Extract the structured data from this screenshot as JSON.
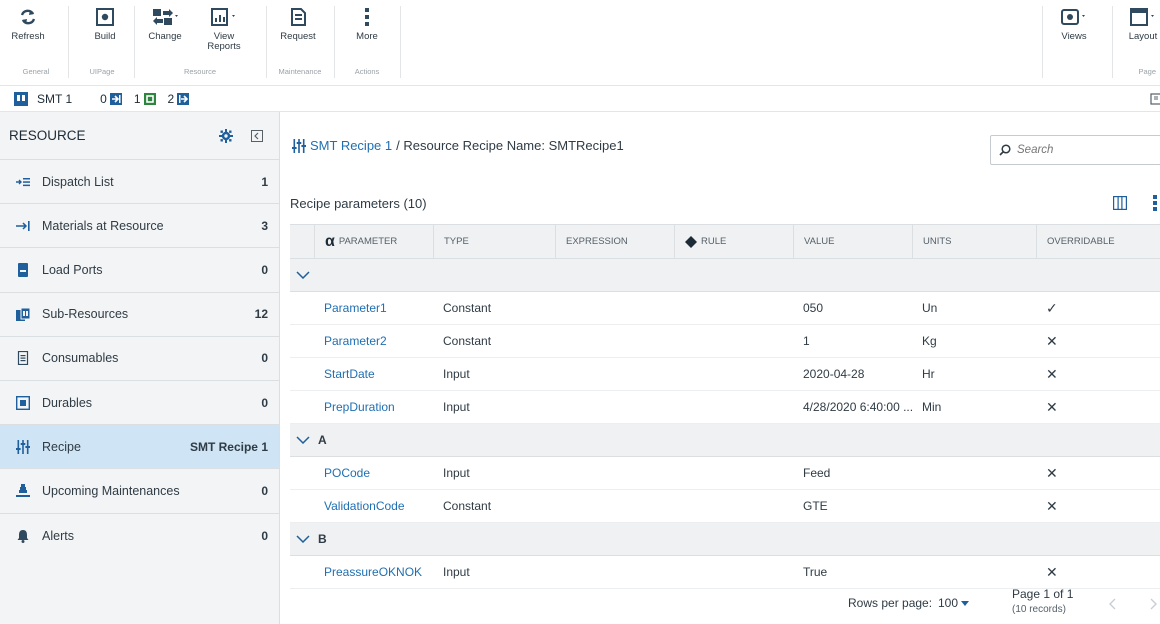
{
  "ribbon": {
    "buttons": [
      {
        "label": "Refresh",
        "icon": "refresh-icon"
      },
      {
        "label": "Build",
        "icon": "build-icon"
      },
      {
        "label": "Change",
        "icon": "change-icon"
      },
      {
        "label": "View Reports",
        "icon": "view-reports-icon"
      },
      {
        "label": "Request",
        "icon": "request-icon"
      },
      {
        "label": "More",
        "icon": "more-icon"
      },
      {
        "label": "Views",
        "icon": "views-icon"
      },
      {
        "label": "Layout",
        "icon": "layout-icon"
      }
    ],
    "groups": [
      "General",
      "UIPage",
      "Resource",
      "Maintenance",
      "Actions",
      "Page"
    ]
  },
  "strip": {
    "resource": "SMT 1",
    "states": [
      {
        "count": "0",
        "icon": "state-in-icon"
      },
      {
        "count": "1",
        "icon": "state-process-icon"
      },
      {
        "count": "2",
        "icon": "state-out-icon"
      }
    ]
  },
  "sidebar": {
    "title": "RESOURCE",
    "items": [
      {
        "label": "Dispatch List",
        "count": "1",
        "icon": "dispatch-list-icon"
      },
      {
        "label": "Materials at Resource",
        "count": "3",
        "icon": "materials-icon"
      },
      {
        "label": "Load Ports",
        "count": "0",
        "icon": "load-ports-icon"
      },
      {
        "label": "Sub-Resources",
        "count": "12",
        "icon": "sub-resources-icon"
      },
      {
        "label": "Consumables",
        "count": "0",
        "icon": "consumables-icon"
      },
      {
        "label": "Durables",
        "count": "0",
        "icon": "durables-icon"
      },
      {
        "label": "Recipe",
        "count": "SMT Recipe 1",
        "icon": "recipe-icon"
      },
      {
        "label": "Upcoming Maintenances",
        "count": "0",
        "icon": "maintenance-icon"
      },
      {
        "label": "Alerts",
        "count": "0",
        "icon": "alerts-icon"
      }
    ]
  },
  "main": {
    "breadcrumb_link": "SMT Recipe 1",
    "breadcrumb_rest": "/ Resource Recipe Name: SMTRecipe1",
    "search_placeholder": "Search",
    "table_title": "Recipe parameters (10)",
    "columns": [
      "PARAMETER",
      "TYPE",
      "EXPRESSION",
      "RULE",
      "VALUE",
      "UNITS",
      "OVERRIDABLE"
    ],
    "groups": [
      {
        "name": "",
        "rows": [
          {
            "parameter": "Parameter1",
            "type": "Constant",
            "expression": "",
            "rule": "",
            "value": "050",
            "units": "Un",
            "overridable": "✓"
          },
          {
            "parameter": "Parameter2",
            "type": "Constant",
            "expression": "",
            "rule": "",
            "value": "1",
            "units": "Kg",
            "overridable": "✕"
          },
          {
            "parameter": "StartDate",
            "type": "Input",
            "expression": "",
            "rule": "",
            "value": "2020-04-28",
            "units": "Hr",
            "overridable": "✕"
          },
          {
            "parameter": "PrepDuration",
            "type": "Input",
            "expression": "",
            "rule": "",
            "value": "4/28/2020 6:40:00 ...",
            "units": "Min",
            "overridable": "✕"
          }
        ]
      },
      {
        "name": "A",
        "rows": [
          {
            "parameter": "POCode",
            "type": "Input",
            "expression": "",
            "rule": "",
            "value": "Feed",
            "units": "",
            "overridable": "✕"
          },
          {
            "parameter": "ValidationCode",
            "type": "Constant",
            "expression": "",
            "rule": "",
            "value": "GTE",
            "units": "",
            "overridable": "✕"
          }
        ]
      },
      {
        "name": "B",
        "rows": [
          {
            "parameter": "PreassureOKNOK",
            "type": "Input",
            "expression": "",
            "rule": "",
            "value": "True",
            "units": "",
            "overridable": "✕"
          }
        ]
      }
    ],
    "footer": {
      "rows_per_page_label": "Rows per page:",
      "rows_per_page_value": "100",
      "page_info": "Page 1 of 1",
      "records": "(10 records)"
    }
  },
  "colors": {
    "accent": "#1f6fb2",
    "active_item": "#cfe4f4",
    "sidebar_bg": "#f3f4f5"
  }
}
